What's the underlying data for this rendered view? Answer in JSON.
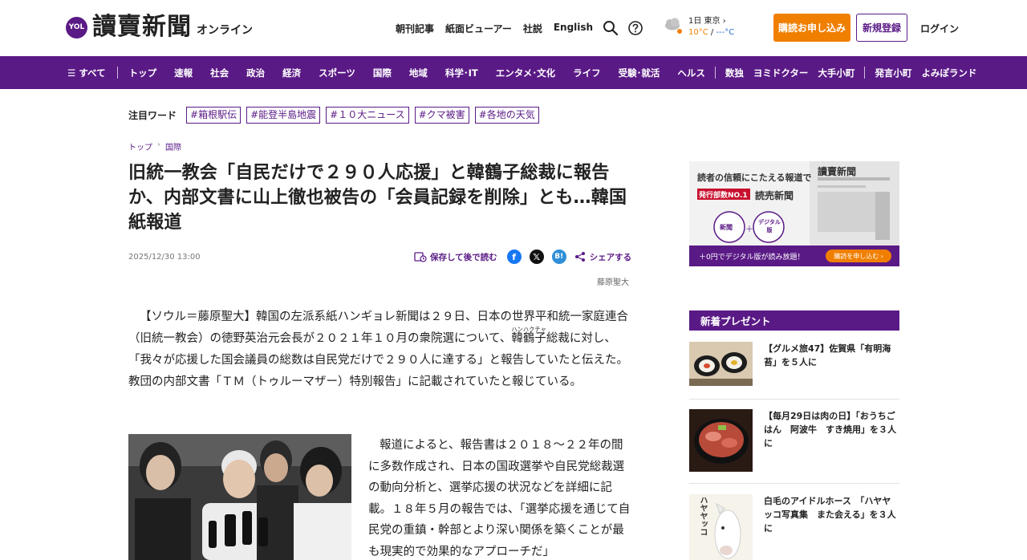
{
  "header": {
    "logo_badge": "YOL",
    "logo_main": "讀賣新聞",
    "logo_sub": "オンライン",
    "nav": [
      "朝刊記事",
      "紙面ビューアー",
      "社説",
      "English"
    ],
    "weather": {
      "location": "1日 東京",
      "temp_hi": "10°C",
      "temp_sep": " / ",
      "temp_lo": "---°C"
    },
    "subscribe_label": "購読お申し込み",
    "register_label": "新規登録",
    "login_label": "ログイン"
  },
  "gnav": {
    "all_label": "すべて",
    "items": [
      "トップ",
      "速報",
      "社会",
      "政治",
      "経済",
      "スポーツ",
      "国際",
      "地域",
      "科学･IT",
      "エンタメ･文化",
      "ライフ",
      "受験･就活",
      "ヘルス"
    ],
    "items2": [
      "数独",
      "ヨミドクター",
      "大手小町"
    ],
    "items3": [
      "発言小町",
      "よみぽランド"
    ]
  },
  "trending": {
    "label": "注目ワード",
    "tags": [
      "#箱根駅伝",
      "#能登半島地震",
      "#１０大ニュース",
      "#クマ被害",
      "#各地の天気"
    ]
  },
  "article": {
    "breadcrumb": [
      "トップ",
      "国際"
    ],
    "title": "旧統一教会「自民だけで２９０人応援」と韓鶴子総裁に報告か、内部文書に山上徹也被告の「会員記録を削除」とも…韓国紙報道",
    "date": "2025/12/30 13:00",
    "save_label": "保存して後で読む",
    "share_label": "シェアする",
    "author": "藤原聖大",
    "lead_1": "【ソウル＝藤原聖大】韓国の左派系紙ハンギョレ新聞は２９日、日本の世界平和統一家庭連合（旧統一教会）の徳野英治元会長が２０２１年１０月の衆院選について、",
    "lead_ruby": "韓鶴子",
    "lead_ruby_reading": "ハンハクチャ",
    "lead_2": "総裁に対し、「我々が応援した国会議員の総数は自民党だけで２９０人に達する」と報告していたと伝えた。教団の内部文書「ＴＭ（トゥルーマザー）特別報告」に記載されていたと報じている。",
    "body_2": "報道によると、報告書は２０１８～２２年の間に多数作成され、日本の国政選挙や自民党総裁選の動向分析と、選挙応援の状況などを詳細に記載。１８年５月の報告では、「選挙応援を通じて自民党の重鎮・幹部とより深い関係を築くことが最も現実的で効果的なアプローチだ」"
  },
  "sidebar": {
    "ad": {
      "line1": "読者の信頼にこたえる報道で",
      "badge": "発行部数NO.1",
      "brand": "読売新聞",
      "circle1": "新聞",
      "plus": "＋",
      "circle2": "デジタル版",
      "masthead": "讀賣新聞",
      "bar_text": "＋0円でデジタル版が読み放題！",
      "bar_button": "購読を申し込む"
    },
    "present_heading": "新着プレゼント",
    "presents": [
      {
        "text": "【グルメ旅47】佐賀県「有明海苔」を５人に"
      },
      {
        "text": "【毎月29日は肉の日】「おうちごはん　阿波牛　すき焼用」を３人に"
      },
      {
        "text": "白毛のアイドルホース　「ハヤヤッコ写真集　また会える」を３人に",
        "thumb_text": "ハヤヤッコ"
      }
    ]
  },
  "colors": {
    "brand_purple": "#5a1a86",
    "accent_orange": "#f07f00"
  }
}
